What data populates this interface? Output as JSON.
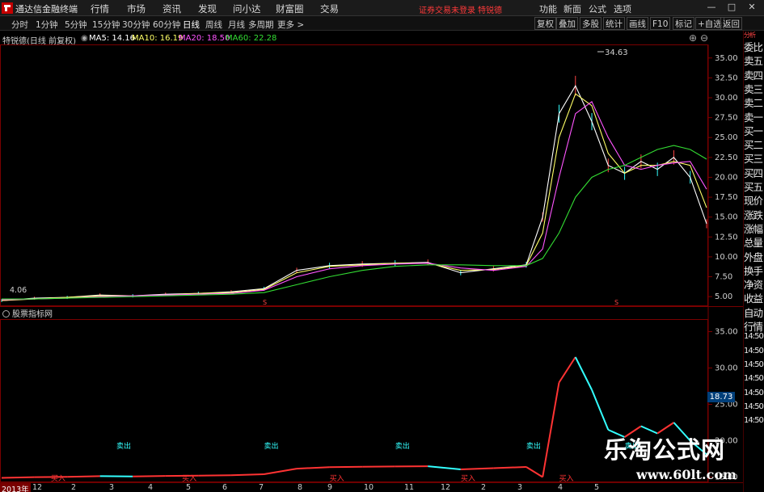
{
  "app": {
    "title": "通达信金融终端",
    "menus": [
      "行情",
      "市场",
      "资讯",
      "发现",
      "问小达",
      "财富圈",
      "交易"
    ],
    "warning": "证券交易未登录",
    "stock_name_top": "特锐德",
    "right_menus": [
      "功能",
      "新面",
      "公式",
      "选项"
    ],
    "window_buttons": [
      "—",
      "□",
      "✕"
    ]
  },
  "toolbar": {
    "periods": [
      "分时",
      "1分钟",
      "5分钟",
      "15分钟",
      "30分钟",
      "60分钟",
      "日线",
      "周线",
      "月线",
      "多周期",
      "更多 >"
    ],
    "active_period": "日线",
    "buttons": [
      "复权",
      "叠加",
      "多股",
      "统计",
      "画线",
      "F10",
      "标记",
      "+自选",
      "返回"
    ]
  },
  "legend": {
    "stock": "特锐德(日线 前复权)",
    "ma5": "MA5: 14.16",
    "ma10": "MA10: 16.19",
    "ma20": "MA20: 18.50",
    "ma60": "MA60: 22.28",
    "colors": {
      "ma5": "#ffffff",
      "ma10": "#ffff66",
      "ma20": "#ff55ff",
      "ma60": "#33dd33"
    }
  },
  "indicator_panel": {
    "title": "股票指标网",
    "buy_label": "买入",
    "sell_label": "卖出"
  },
  "right_panel": {
    "top_label": "分析",
    "items": [
      "委比",
      "卖五",
      "卖四",
      "卖三",
      "卖二",
      "卖一",
      "买一",
      "买二",
      "买三",
      "买四",
      "买五",
      "现价",
      "涨跌",
      "涨幅",
      "总量",
      "外盘",
      "换手",
      "净资",
      "收益",
      "自动",
      "行情",
      "14:50",
      "14:50",
      "14:50",
      "14:50",
      "14:50",
      "14:50",
      "14:50"
    ],
    "price_readout": "18.73"
  },
  "watermark": {
    "text": "乐淘公式网",
    "url": "www.60lt.com"
  },
  "xaxis": {
    "year": "2013年",
    "labels": [
      "12",
      "2",
      "3",
      "4",
      "5",
      "6",
      "7",
      "8",
      "9",
      "10",
      "11",
      "12",
      "2",
      "3",
      "4",
      "5"
    ]
  },
  "chart_data": [
    {
      "type": "line",
      "title": "特锐德(日线 前复权)",
      "ylim": [
        4.0,
        36.5
      ],
      "yticks": [
        "35.00",
        "32.50",
        "30.00",
        "27.50",
        "25.00",
        "22.50",
        "20.00",
        "17.50",
        "15.00",
        "12.50",
        "10.00",
        "7.50",
        "5.00"
      ],
      "annotations": {
        "high": "34.63",
        "low": "4.06"
      },
      "x": [
        0,
        10,
        20,
        30,
        40,
        50,
        60,
        70,
        80,
        90,
        100,
        110,
        120,
        130,
        140,
        150,
        160,
        165,
        170,
        175,
        180,
        185,
        190,
        195,
        200,
        205,
        210,
        215
      ],
      "series": [
        {
          "name": "MA5",
          "color": "#ffffff",
          "values": [
            4.5,
            4.8,
            4.9,
            5.2,
            5.1,
            5.3,
            5.4,
            5.6,
            6.0,
            8.3,
            8.9,
            9.1,
            9.2,
            9.3,
            8.0,
            8.5,
            9.0,
            15.0,
            28.0,
            31.5,
            27.0,
            21.5,
            20.5,
            22.0,
            21.0,
            22.5,
            20.0,
            14.16
          ]
        },
        {
          "name": "MA10",
          "color": "#ffff66",
          "values": [
            4.5,
            4.7,
            4.9,
            5.1,
            5.1,
            5.2,
            5.4,
            5.5,
            5.9,
            8.0,
            8.8,
            9.0,
            9.2,
            9.2,
            8.3,
            8.4,
            8.9,
            13.0,
            25.0,
            30.5,
            29.0,
            23.0,
            20.5,
            21.5,
            21.5,
            22.0,
            21.5,
            16.19
          ]
        },
        {
          "name": "MA20",
          "color": "#ff55ff",
          "values": [
            4.6,
            4.7,
            4.8,
            5.0,
            5.1,
            5.2,
            5.3,
            5.4,
            5.8,
            7.5,
            8.5,
            8.9,
            9.1,
            9.2,
            8.6,
            8.3,
            8.8,
            11.0,
            20.0,
            28.0,
            29.5,
            25.0,
            21.5,
            21.0,
            21.5,
            21.8,
            22.0,
            18.5
          ]
        },
        {
          "name": "MA60",
          "color": "#33dd33",
          "values": [
            4.7,
            4.7,
            4.8,
            4.9,
            5.0,
            5.1,
            5.2,
            5.3,
            5.5,
            6.5,
            7.5,
            8.3,
            8.8,
            9.0,
            9.0,
            8.9,
            8.9,
            9.8,
            13.0,
            17.5,
            20.0,
            21.0,
            21.5,
            22.5,
            23.5,
            24.0,
            23.5,
            22.28
          ]
        }
      ]
    },
    {
      "type": "line",
      "title": "股票指标网",
      "ylim": [
        14.5,
        36.5
      ],
      "yticks": [
        "35.00",
        "30.00",
        "25.00",
        "20.00",
        "15.00"
      ],
      "series": [
        {
          "name": "买入",
          "color": "#ff3333"
        },
        {
          "name": "卖出",
          "color": "#33ffff"
        }
      ]
    }
  ]
}
